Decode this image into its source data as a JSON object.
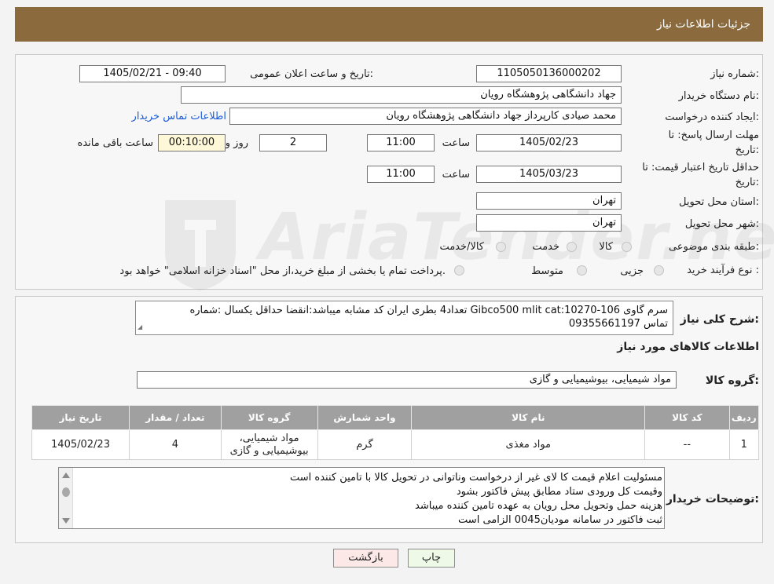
{
  "header": {
    "title": "جزئیات اطلاعات نیاز"
  },
  "form": {
    "need_number_label": "شماره نیاز:",
    "need_number": "1105050136000202",
    "announce_label": "تاریخ و ساعت اعلان عمومی:",
    "announce_value": "1405/02/21 - 09:40",
    "buyer_org_label": "نام دستگاه خریدار:",
    "buyer_org": "جهاد دانشگاهی پژوهشگاه رویان",
    "creator_label": "ایجاد کننده درخواست:",
    "creator": "محمد صیادی کارپرداز جهاد دانشگاهی پژوهشگاه رویان",
    "contact_link": "اطلاعات تماس خریدار",
    "deadline_label_1": "مهلت ارسال پاسخ: تا",
    "deadline_label_2": "تاریخ:",
    "deadline_date": "1405/02/23",
    "time_label": "ساعت",
    "deadline_time": "11:00",
    "days": "2",
    "days_label": "روز و",
    "remaining": "00:10:00",
    "remaining_label": "ساعت باقی مانده",
    "validity_label_1": "حداقل تاریخ اعتبار قیمت: تا",
    "validity_label_2": "تاریخ:",
    "validity_date": "1405/03/23",
    "validity_time": "11:00",
    "province_label": "استان محل تحویل:",
    "province": "تهران",
    "city_label": "شهر محل تحویل:",
    "city": "تهران",
    "category_label": "طبقه بندی موضوعی:",
    "category_options": [
      "کالا",
      "خدمت",
      "کالا/خدمت"
    ],
    "process_label": "نوع فرآیند خرید :",
    "process_options": [
      "جزیی",
      "متوسط"
    ],
    "process_note": "پرداخت تمام یا بخشی از مبلغ خرید،از محل \"اسناد خزانه اسلامی\" خواهد بود."
  },
  "watermark": {
    "text": "AriaTender.neT"
  },
  "details": {
    "summary_label": "شرح کلی نیاز:",
    "summary_line1": "سرم گاوی Gibco500 mlit cat:10270-106  تعداد4 بطری  ایران کد مشابه میباشد:انقضا حداقل یکسال :شماره",
    "summary_line2": "تماس 09355661197",
    "goods_info_title": "اطلاعات کالاهای مورد نیاز",
    "goods_group_label": "گروه کالا:",
    "goods_group": "مواد شیمیایی، بیوشیمیایی و  گازی"
  },
  "table": {
    "headers": [
      "ردیف",
      "کد کالا",
      "نام کالا",
      "واحد شمارش",
      "گروه کالا",
      "تعداد / مقدار",
      "تاریخ نیاز"
    ],
    "rows": [
      {
        "row": "1",
        "code": "--",
        "name": "مواد مغذی",
        "unit": "گرم",
        "group_line1": "مواد شیمیایی،",
        "group_line2": "بیوشیمیایی و گازی",
        "qty": "4",
        "date": "1405/02/23"
      }
    ]
  },
  "notes": {
    "label": "توضیحات خریدار:",
    "lines": [
      "مسئولیت اعلام قیمت کا لای  غیر از درخواست وناتوانی در تحویل کالا با تامین کننده است",
      "وقیمت کل ورودی ستاد مطابق پیش فاکتور بشود",
      "هزینه حمل وتحویل محل رویان به عهده تامین کننده میباشد",
      "ثبت فاکتور در سامانه مودیان0045 الزامی است"
    ]
  },
  "buttons": {
    "print": "چاپ",
    "back": "بازگشت"
  }
}
